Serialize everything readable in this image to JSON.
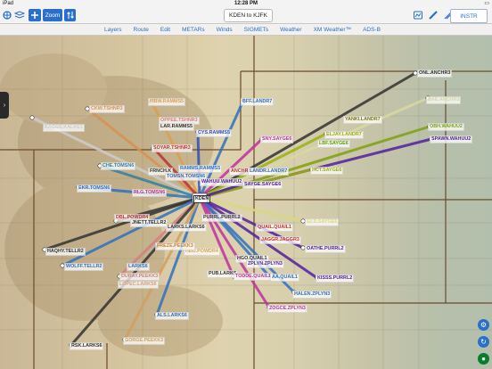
{
  "status_bar": {
    "carrier": "iPad",
    "time": "12:28 PM",
    "battery": "▮"
  },
  "toolbar": {
    "zoom_label": "Zoom",
    "route_label": "KDEN to KJFK",
    "instr_label": "INSTR"
  },
  "menu": {
    "items": [
      "Layers",
      "Route",
      "Edit",
      "METARs",
      "Winds",
      "SIGMETs",
      "Weather",
      "XM Weather™",
      "ADS-B"
    ]
  },
  "map": {
    "hub": "KDEN",
    "labels": [
      {
        "text": "ONL.ANCHR3",
        "color": "#333333"
      },
      {
        "text": "BAE.ANCHR3",
        "color": "#d8d8a0"
      },
      {
        "text": "YANKI.LANDR7",
        "color": "#7a7a10"
      },
      {
        "text": "ELJAY.LANDR7",
        "color": "#9ab010"
      },
      {
        "text": "OBH.WAHUU2",
        "color": "#7ea010"
      },
      {
        "text": "SPAWN.WAHUU2",
        "color": "#5020a0"
      },
      {
        "text": "HCT.SAYGE6",
        "color": "#9ab010"
      },
      {
        "text": "LBF.SAYGE6",
        "color": "#5aa010"
      },
      {
        "text": "SNY.SAYGE6",
        "color": "#c030a0"
      },
      {
        "text": "BFF.LANDR7",
        "color": "#3070c0"
      },
      {
        "text": "MBW.RAMMS5",
        "color": "#d8a050"
      },
      {
        "text": "CKW.TSHNR3",
        "color": "#d89050"
      },
      {
        "text": "OPPEE.TSHNR3",
        "color": "#d08080"
      },
      {
        "text": "LAR.RAMMS5",
        "color": "#333333"
      },
      {
        "text": "CYS.RAMMS5",
        "color": "#3050c0"
      },
      {
        "text": "BAGGS.KALKE1",
        "color": "#cccccc"
      },
      {
        "text": "SOYAR.TSHNR3",
        "color": "#c03030"
      },
      {
        "text": "CHE.TOMSN6",
        "color": "#3080a0"
      },
      {
        "text": "FRNCH.K",
        "color": "#333333"
      },
      {
        "text": "RAMMS.RAMMS5",
        "color": "#3070c0"
      },
      {
        "text": "ANCHR.ANCHR3",
        "color": "#c03030"
      },
      {
        "text": "LANDR.LANDR7",
        "color": "#3070c0"
      },
      {
        "text": "TOMSN.TOMSN6",
        "color": "#3070c0"
      },
      {
        "text": "WAHUU.WAHUU2",
        "color": "#5020a0"
      },
      {
        "text": "SAYGE.SAYGE6",
        "color": "#5020a0"
      },
      {
        "text": "EKR.TOMSN6",
        "color": "#3070c0"
      },
      {
        "text": "RLG.TOMSN6",
        "color": "#c03080"
      },
      {
        "text": "GLD.SAYGE6",
        "color": "#d8d880"
      },
      {
        "text": "DBL.POWDR4",
        "color": "#c03030"
      },
      {
        "text": "JNETT.TELLR2",
        "color": "#333333"
      },
      {
        "text": "PURRL.PURRL2",
        "color": "#333333"
      },
      {
        "text": "LARKS.LARKS6",
        "color": "#333333"
      },
      {
        "text": "QUAIL.QUAIL1",
        "color": "#c03030"
      },
      {
        "text": "JAGGR.JAGGR3",
        "color": "#c03030"
      },
      {
        "text": "OATHE.PURRL2",
        "color": "#5020a0"
      },
      {
        "text": "HBU.POWDR4",
        "color": "#d8a050"
      },
      {
        "text": "HAQHY.TELLR2",
        "color": "#333333"
      },
      {
        "text": "FREZE.PEEKK3",
        "color": "#d08030"
      },
      {
        "text": "HGO.QUAIL1",
        "color": "#333333"
      },
      {
        "text": "ZPLYN.ZPLYN3",
        "color": "#5020a0"
      },
      {
        "text": "WOLFF.TELLR2",
        "color": "#3070c0"
      },
      {
        "text": "LARKS6",
        "color": "#3070c0"
      },
      {
        "text": "PUB.LARKS",
        "color": "#333333"
      },
      {
        "text": "KISSS.PURRL2",
        "color": "#5020a0"
      },
      {
        "text": "DURAY.PEEKK3",
        "color": "#d08080"
      },
      {
        "text": "LOPEC.LARKS6",
        "color": "#d0a080"
      },
      {
        "text": "TODDE.QUAIL1",
        "color": "#c030a0"
      },
      {
        "text": "AA.QUAIL1",
        "color": "#3070c0"
      },
      {
        "text": "HALEN.ZPLYN3",
        "color": "#3070c0"
      },
      {
        "text": "ZOGCE.ZPLYN3",
        "color": "#c030a0"
      },
      {
        "text": "ALS.LARKS6",
        "color": "#3070c0"
      },
      {
        "text": "RSK.LARKS6",
        "color": "#333333"
      },
      {
        "text": "GORGE.PEEKK3",
        "color": "#d0a060"
      }
    ]
  }
}
